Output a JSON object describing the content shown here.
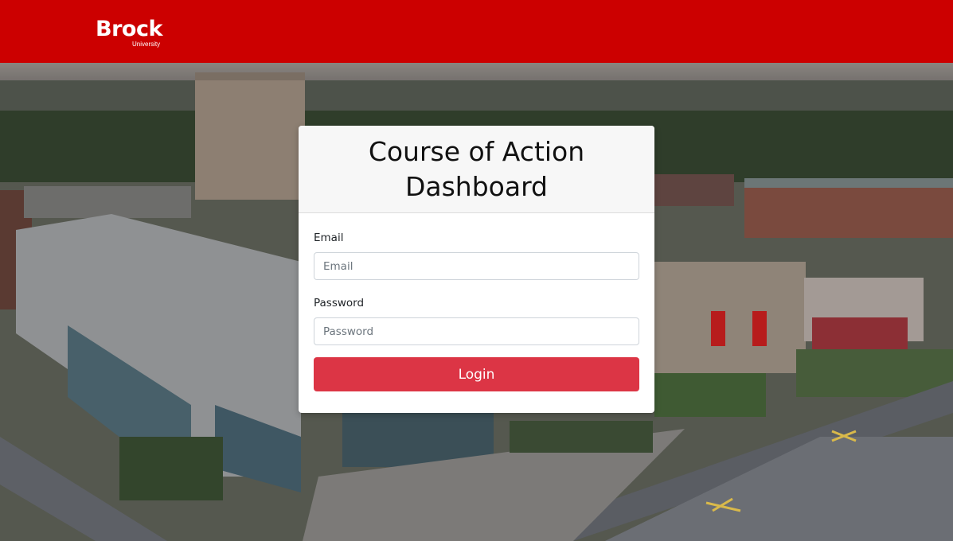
{
  "header": {
    "logo_text": "Brock",
    "logo_subtext": "University",
    "brand_color": "#cc0000"
  },
  "card": {
    "title": "Course of Action Dashboard",
    "email_label": "Email",
    "email_placeholder": "Email",
    "password_label": "Password",
    "password_placeholder": "Password",
    "login_label": "Login",
    "button_color": "#dc3545"
  }
}
